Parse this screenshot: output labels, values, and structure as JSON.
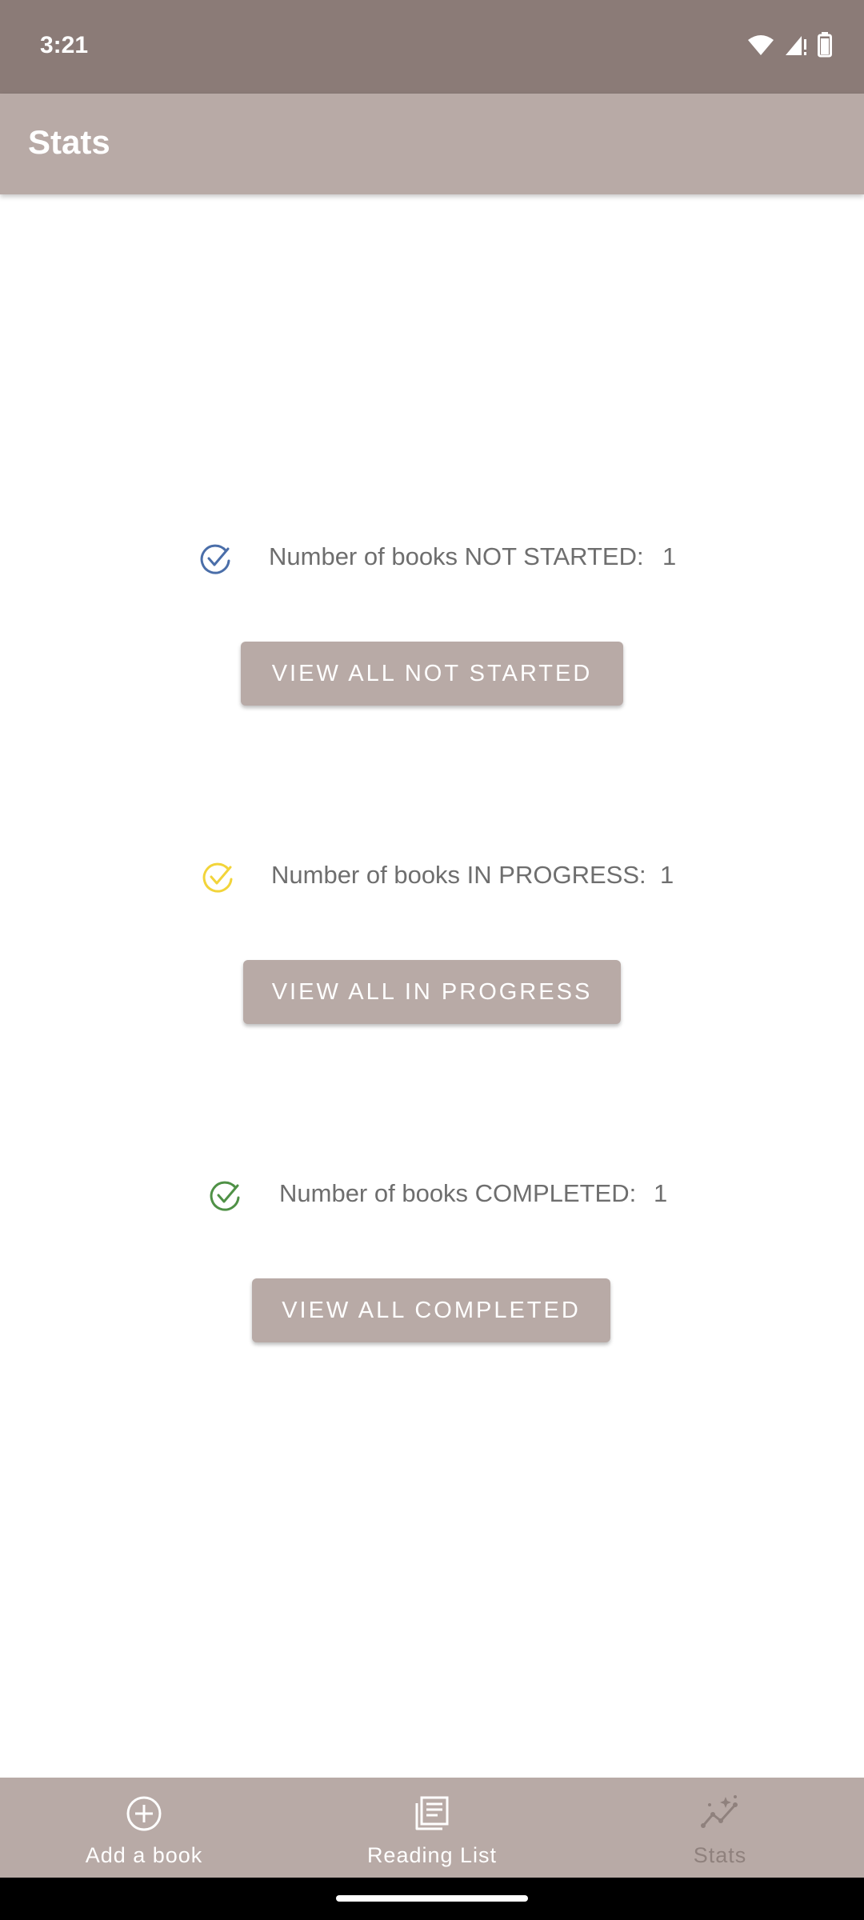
{
  "status_bar": {
    "time": "3:21",
    "icons": [
      "wifi-icon",
      "signal-icon",
      "battery-icon"
    ]
  },
  "app_bar": {
    "title": "Stats"
  },
  "stats": [
    {
      "label": "Number of books NOT STARTED:",
      "count": "1",
      "icon": "check-circle-icon",
      "icon_color": "#4a6ea9",
      "button_label": "VIEW ALL NOT STARTED"
    },
    {
      "label": "Number of books IN PROGRESS:",
      "count": "1",
      "icon": "check-circle-icon",
      "icon_color": "#f2d43a",
      "button_label": "VIEW ALL IN PROGRESS"
    },
    {
      "label": "Number of books COMPLETED:",
      "count": "1",
      "icon": "check-circle-icon",
      "icon_color": "#4f9146",
      "button_label": "VIEW ALL COMPLETED"
    }
  ],
  "bottom_nav": {
    "items": [
      {
        "label": "Add a book",
        "icon": "add-circle-icon",
        "active": false
      },
      {
        "label": "Reading List",
        "icon": "reading-list-icon",
        "active": false
      },
      {
        "label": "Stats",
        "icon": "stats-icon",
        "active": true
      }
    ]
  },
  "colors": {
    "status_bar": "#8b7b77",
    "primary": "#b8aaa6",
    "text_muted": "#6e6e6e",
    "nav_active": "#8f817d"
  }
}
